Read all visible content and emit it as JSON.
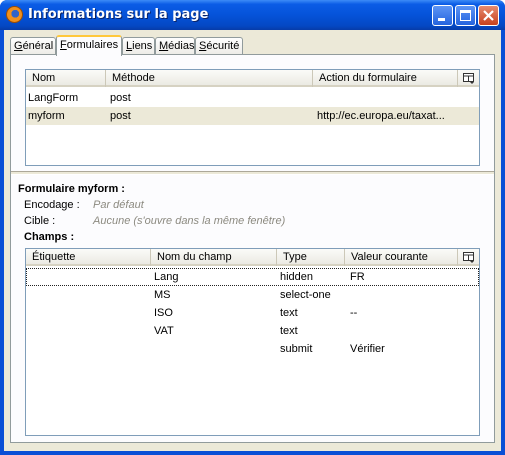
{
  "window": {
    "title": "Informations sur la page"
  },
  "tabs": [
    {
      "label": "Général",
      "accel": "G",
      "rest": "énéral"
    },
    {
      "label": "Formulaires",
      "accel": "F",
      "rest": "ormulaires"
    },
    {
      "label": "Liens",
      "accel": "L",
      "rest": "iens"
    },
    {
      "label": "Médias",
      "accel": "M",
      "rest": "édias"
    },
    {
      "label": "Sécurité",
      "accel": "S",
      "rest": "écurité"
    }
  ],
  "forms": {
    "columns": [
      "Nom",
      "Méthode",
      "Action du formulaire"
    ],
    "rows": [
      {
        "name": "LangForm",
        "method": "post",
        "action": ""
      },
      {
        "name": "myform",
        "method": "post",
        "action": "http://ec.europa.eu/taxat..."
      }
    ]
  },
  "details": {
    "heading": "Formulaire myform :",
    "encoding_label": "Encodage :",
    "encoding_value": "Par défaut",
    "target_label": "Cible :",
    "target_value": "Aucune (s'ouvre dans la même fenêtre)",
    "fields_label": "Champs :"
  },
  "fields": {
    "columns": [
      "Étiquette",
      "Nom du champ",
      "Type",
      "Valeur courante"
    ],
    "rows": [
      {
        "label": "",
        "name": "Lang",
        "type": "hidden",
        "value": "FR"
      },
      {
        "label": "",
        "name": "MS",
        "type": "select-one",
        "value": ""
      },
      {
        "label": "",
        "name": "ISO",
        "type": "text",
        "value": "--"
      },
      {
        "label": "",
        "name": "VAT",
        "type": "text",
        "value": ""
      },
      {
        "label": "",
        "name": "",
        "type": "submit",
        "value": "Vérifier"
      }
    ]
  },
  "colors": {
    "title_bar": "#0553d9",
    "selection": "#ece9d8",
    "active_tab_accent": "#ffc83c"
  }
}
